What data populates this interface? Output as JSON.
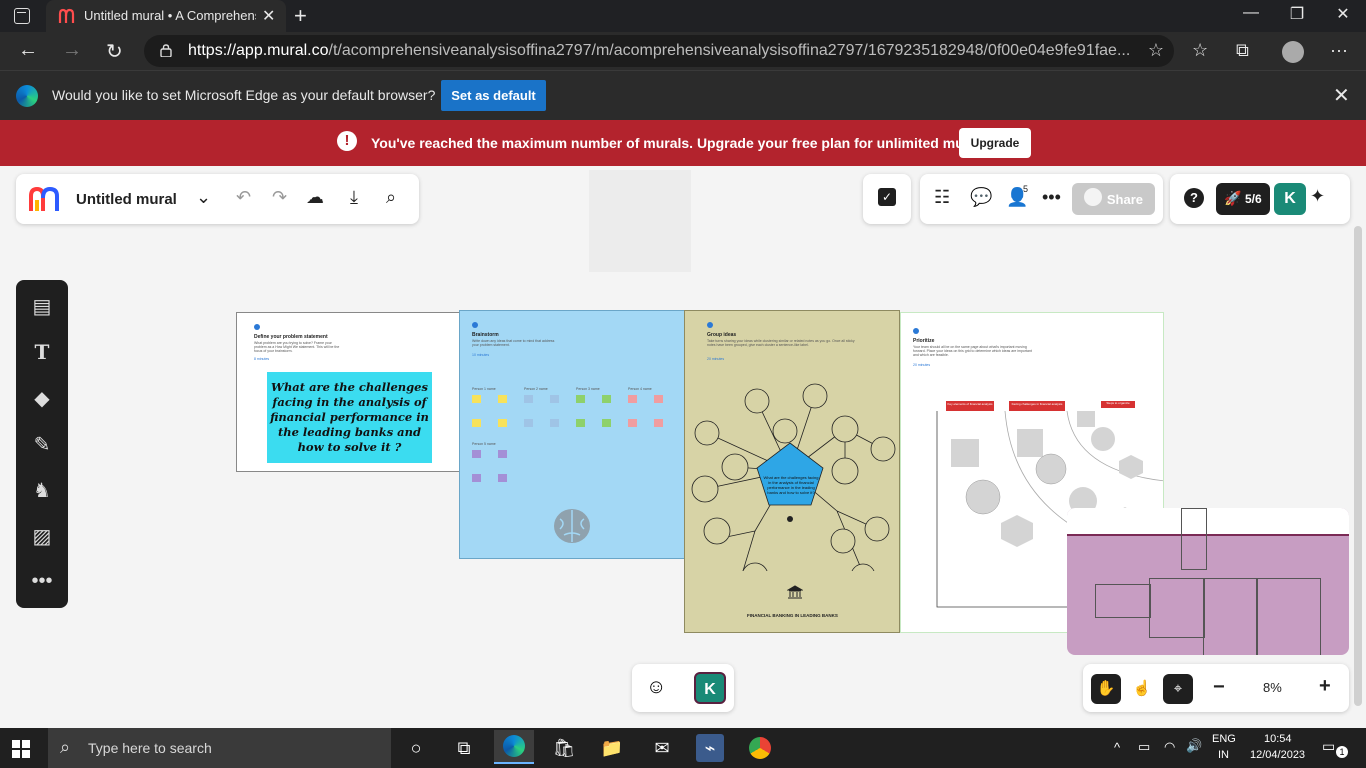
{
  "browser": {
    "tab_title": "Untitled mural • A Comprehensi",
    "new_tab_glyph": "+",
    "url_host": "https://app.mural.co",
    "url_path": "/t/acomprehensiveanalysisoffina2797/m/acomprehensiveanalysisoffina2797/1679235182948/0f00e04e9fe91fae..."
  },
  "edge_prompt": {
    "message": "Would you like to set Microsoft Edge as your default browser?",
    "button": "Set as default"
  },
  "limit_banner": {
    "message": "You've reached the maximum number of murals. Upgrade your free plan for unlimited murals.",
    "button": "Upgrade"
  },
  "mural": {
    "title": "Untitled mural",
    "share_label": "Share",
    "members_count": "5",
    "onboarding_progress": "5/6",
    "user_initial": "K",
    "zoom": "8%"
  },
  "boards": {
    "problem": {
      "number": "1",
      "title": "Define your problem statement",
      "subtitle": "What problem are you trying to solve? Frame your problem as a How Might We statement. This will be the focus of your brainstorm.",
      "tip": "8 minutes",
      "statement": "What are the challenges facing in the analysis of financial performance in the leading banks and how to solve it ?"
    },
    "brainstorm": {
      "number": "2",
      "title": "Brainstorm",
      "subtitle": "Write down any ideas that come to mind that address your problem statement.",
      "tip": "10 minutes",
      "groups": [
        "Person 1 name",
        "Person 2 name",
        "Person 3 name",
        "Person 4 name",
        "Person 5 name"
      ]
    },
    "group": {
      "number": "3",
      "title": "Group ideas",
      "subtitle": "Take turns sharing your ideas while clustering similar or related notes as you go. Once all sticky notes have been grouped, give each cluster a sentence-like label.",
      "tip": "20 minutes",
      "center": "What are the challenges facing in the analysis of financial performance in the leading banks and how to solve it?",
      "footer": "FINANCIAL BANKING IN LEADING BANKS"
    },
    "prioritize": {
      "number": "4",
      "title": "Prioritize",
      "subtitle": "Your team should all be on the same page about what's important moving forward. Place your ideas on this grid to determine which ideas are important and which are feasible.",
      "tip": "20 minutes",
      "headers": [
        "Key elements of financial analysis",
        "Facing challenges in financial analysis",
        "Steps to organize"
      ]
    }
  },
  "taskbar": {
    "search_placeholder": "Type here to search",
    "lang_top": "ENG",
    "lang_bottom": "IN",
    "time": "10:54",
    "date": "12/04/2023",
    "notifications": "1"
  },
  "colors": {
    "red_banner": "#b3232d",
    "edge_button": "#1a73c8",
    "board_blue": "#a3d8f5",
    "board_olive": "#d7d3a6",
    "statement_cyan": "#3bdcf0",
    "minimap": "#c79dc2",
    "avatar_green": "#1a8a77"
  }
}
